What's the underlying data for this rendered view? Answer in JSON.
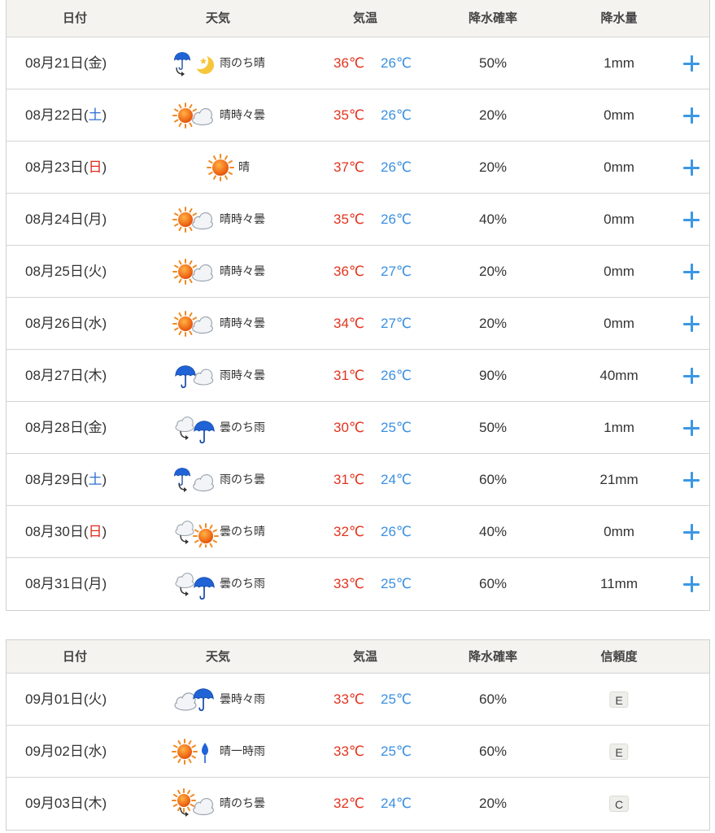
{
  "table1": {
    "headers": {
      "date": "日付",
      "weather": "天気",
      "temp": "気温",
      "pop": "降水確率",
      "amount": "降水量"
    },
    "rows": [
      {
        "date": "08月21日",
        "dow": "金",
        "dowType": "weekday",
        "icon": "rain-then-moon-icon",
        "weather": "雨のち晴",
        "hi": "36℃",
        "lo": "26℃",
        "pop": "50%",
        "amount": "1mm"
      },
      {
        "date": "08月22日",
        "dow": "土",
        "dowType": "sat",
        "icon": "sun-with-cloud-icon",
        "weather": "晴時々曇",
        "hi": "35℃",
        "lo": "26℃",
        "pop": "20%",
        "amount": "0mm"
      },
      {
        "date": "08月23日",
        "dow": "日",
        "dowType": "sun",
        "icon": "sun-icon",
        "weather": "晴",
        "hi": "37℃",
        "lo": "26℃",
        "pop": "20%",
        "amount": "0mm"
      },
      {
        "date": "08月24日",
        "dow": "月",
        "dowType": "weekday",
        "icon": "sun-with-cloud-icon",
        "weather": "晴時々曇",
        "hi": "35℃",
        "lo": "26℃",
        "pop": "40%",
        "amount": "0mm"
      },
      {
        "date": "08月25日",
        "dow": "火",
        "dowType": "weekday",
        "icon": "sun-with-cloud-icon",
        "weather": "晴時々曇",
        "hi": "36℃",
        "lo": "27℃",
        "pop": "20%",
        "amount": "0mm"
      },
      {
        "date": "08月26日",
        "dow": "水",
        "dowType": "weekday",
        "icon": "sun-with-cloud-icon",
        "weather": "晴時々曇",
        "hi": "34℃",
        "lo": "27℃",
        "pop": "20%",
        "amount": "0mm"
      },
      {
        "date": "08月27日",
        "dow": "木",
        "dowType": "weekday",
        "icon": "rain-with-cloud-icon",
        "weather": "雨時々曇",
        "hi": "31℃",
        "lo": "26℃",
        "pop": "90%",
        "amount": "40mm"
      },
      {
        "date": "08月28日",
        "dow": "金",
        "dowType": "weekday",
        "icon": "cloud-then-rain-icon",
        "weather": "曇のち雨",
        "hi": "30℃",
        "lo": "25℃",
        "pop": "50%",
        "amount": "1mm"
      },
      {
        "date": "08月29日",
        "dow": "土",
        "dowType": "sat",
        "icon": "rain-then-cloud-icon",
        "weather": "雨のち曇",
        "hi": "31℃",
        "lo": "24℃",
        "pop": "60%",
        "amount": "21mm"
      },
      {
        "date": "08月30日",
        "dow": "日",
        "dowType": "sun",
        "icon": "cloud-then-sun-icon",
        "weather": "曇のち晴",
        "hi": "32℃",
        "lo": "26℃",
        "pop": "40%",
        "amount": "0mm"
      },
      {
        "date": "08月31日",
        "dow": "月",
        "dowType": "weekday",
        "icon": "cloud-then-rain-icon",
        "weather": "曇のち雨",
        "hi": "33℃",
        "lo": "25℃",
        "pop": "60%",
        "amount": "11mm"
      }
    ]
  },
  "table2": {
    "headers": {
      "date": "日付",
      "weather": "天気",
      "temp": "気温",
      "pop": "降水確率",
      "reliability": "信頼度"
    },
    "rows": [
      {
        "date": "09月01日",
        "dow": "火",
        "dowType": "weekday",
        "icon": "cloud-with-rain-icon",
        "weather": "曇時々雨",
        "hi": "33℃",
        "lo": "25℃",
        "pop": "60%",
        "reliability": "E"
      },
      {
        "date": "09月02日",
        "dow": "水",
        "dowType": "weekday",
        "icon": "sun-with-rain-icon",
        "weather": "晴一時雨",
        "hi": "33℃",
        "lo": "25℃",
        "pop": "60%",
        "reliability": "E"
      },
      {
        "date": "09月03日",
        "dow": "木",
        "dowType": "weekday",
        "icon": "sun-then-cloud-icon",
        "weather": "晴のち曇",
        "hi": "32℃",
        "lo": "24℃",
        "pop": "20%",
        "reliability": "C"
      }
    ]
  },
  "colors": {
    "high": "#e2331e",
    "low": "#3a8fe0",
    "saturday": "#2f6fd0",
    "sunday": "#e02a1a",
    "plus": "#3b97e4",
    "header_bg": "#f5f3ef"
  }
}
